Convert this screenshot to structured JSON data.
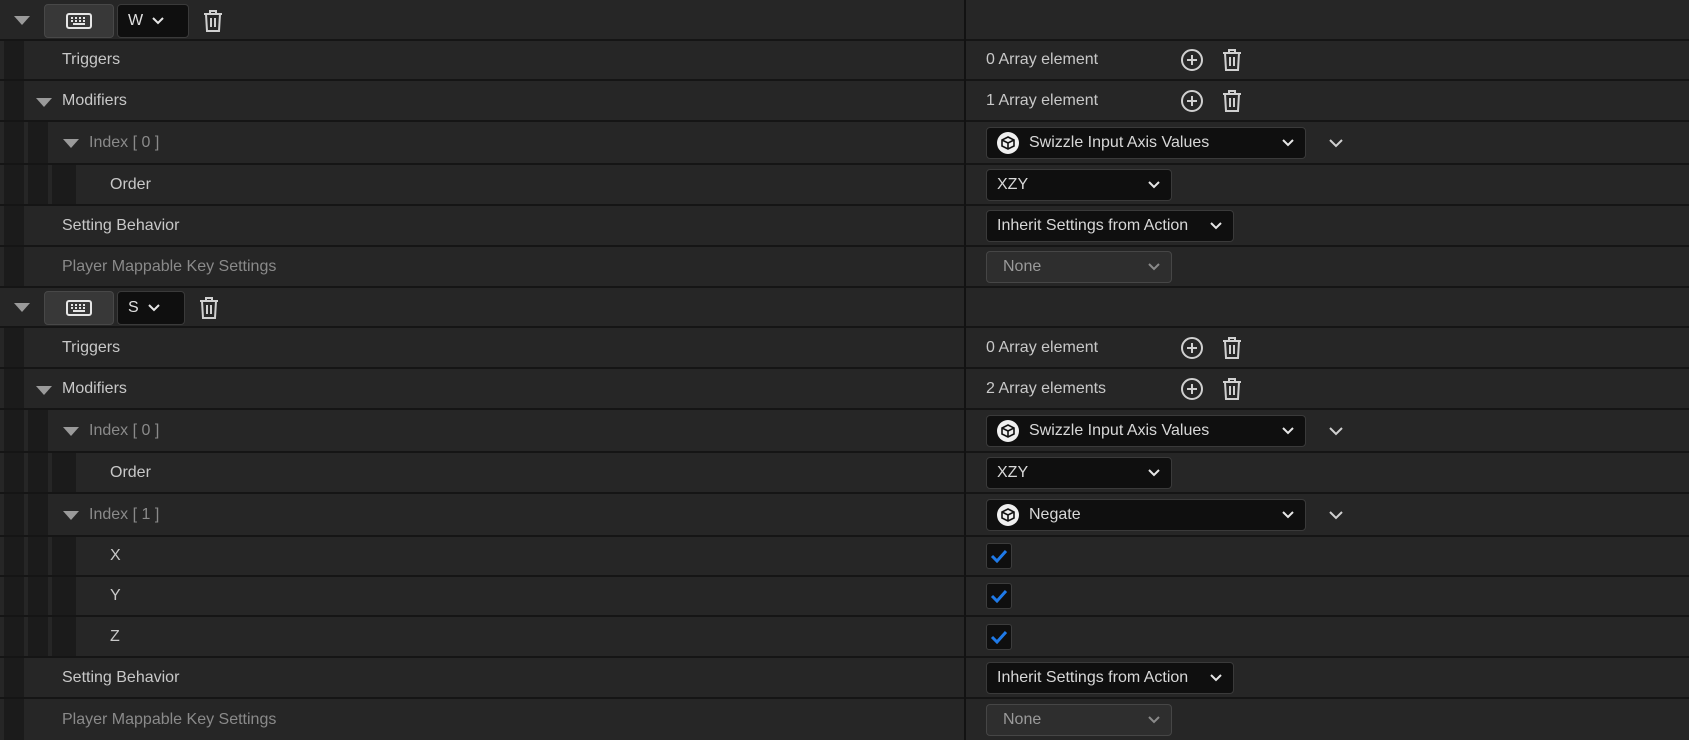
{
  "mappings": [
    {
      "key": "W",
      "triggers": {
        "label": "Triggers",
        "count": "0 Array element"
      },
      "modifiers": {
        "label": "Modifiers",
        "count": "1 Array element"
      },
      "index0": {
        "label": "Index [ 0 ]",
        "modifier": "Swizzle Input Axis Values",
        "order_label": "Order",
        "order_value": "XZY"
      },
      "setting_behavior": {
        "label": "Setting Behavior",
        "value": "Inherit Settings from Action"
      },
      "player_mappable": {
        "label": "Player Mappable Key Settings",
        "value": "None"
      }
    },
    {
      "key": "S",
      "triggers": {
        "label": "Triggers",
        "count": "0 Array element"
      },
      "modifiers": {
        "label": "Modifiers",
        "count": "2 Array elements"
      },
      "index0": {
        "label": "Index [ 0 ]",
        "modifier": "Swizzle Input Axis Values",
        "order_label": "Order",
        "order_value": "XZY"
      },
      "index1": {
        "label": "Index [ 1 ]",
        "modifier": "Negate",
        "axes": [
          {
            "label": "X",
            "checked": true
          },
          {
            "label": "Y",
            "checked": true
          },
          {
            "label": "Z",
            "checked": true
          }
        ]
      },
      "setting_behavior": {
        "label": "Setting Behavior",
        "value": "Inherit Settings from Action"
      },
      "player_mappable": {
        "label": "Player Mappable Key Settings",
        "value": "None"
      }
    }
  ],
  "colors": {
    "check_accent": "#1f7ae8",
    "bg": "#262626"
  }
}
